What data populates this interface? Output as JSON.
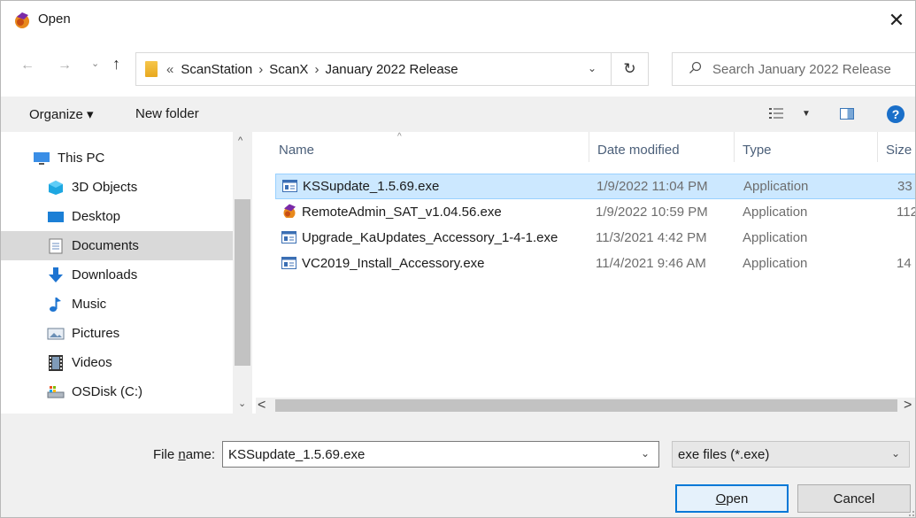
{
  "window": {
    "title": "Open",
    "close_glyph": "✕"
  },
  "nav": {
    "back_glyph": "←",
    "forward_glyph": "→",
    "recent_glyph": "⌄",
    "up_glyph": "↑",
    "breadcrumb": {
      "overflow_glyph": "«",
      "separator": "›",
      "parts": [
        "ScanStation",
        "ScanX",
        "January 2022 Release"
      ]
    },
    "address_dropdown_glyph": "⌄",
    "refresh_glyph": "↻",
    "search_icon_glyph": "⚲",
    "search_placeholder": "Search January 2022 Release"
  },
  "toolbar": {
    "organize_label": "Organize ▾",
    "new_folder_label": "New folder",
    "view_dropdown_glyph": "▼",
    "help_glyph": "?"
  },
  "sidebar": {
    "scroll_up_glyph": "^",
    "scroll_down_glyph": "⌄",
    "items": [
      {
        "label": "This PC",
        "icon": "computer-icon",
        "selected": false
      },
      {
        "label": "3D Objects",
        "icon": "cube-icon",
        "selected": false
      },
      {
        "label": "Desktop",
        "icon": "desktop-icon",
        "selected": false
      },
      {
        "label": "Documents",
        "icon": "document-icon",
        "selected": true
      },
      {
        "label": "Downloads",
        "icon": "download-icon",
        "selected": false
      },
      {
        "label": "Music",
        "icon": "music-note-icon",
        "selected": false
      },
      {
        "label": "Pictures",
        "icon": "pictures-icon",
        "selected": false
      },
      {
        "label": "Videos",
        "icon": "film-icon",
        "selected": false
      },
      {
        "label": "OSDisk (C:)",
        "icon": "drive-icon",
        "selected": false
      }
    ]
  },
  "filelist": {
    "sort_glyph": "^",
    "columns": [
      "Name",
      "Date modified",
      "Type",
      "Size"
    ],
    "rows": [
      {
        "name": "KSSupdate_1.5.69.exe",
        "date": "1/9/2022 11:04 PM",
        "type": "Application",
        "size": "33",
        "icon": "exe-icon",
        "selected": true
      },
      {
        "name": "RemoteAdmin_SAT_v1.04.56.exe",
        "date": "1/9/2022 10:59 PM",
        "type": "Application",
        "size": "112",
        "icon": "app-logo-icon",
        "selected": false
      },
      {
        "name": "Upgrade_KaUpdates_Accessory_1-4-1.exe",
        "date": "11/3/2021 4:42 PM",
        "type": "Application",
        "size": "",
        "icon": "exe-icon",
        "selected": false
      },
      {
        "name": "VC2019_Install_Accessory.exe",
        "date": "11/4/2021 9:46 AM",
        "type": "Application",
        "size": "14",
        "icon": "exe-icon",
        "selected": false
      }
    ],
    "scroll_left_glyph": "<",
    "scroll_right_glyph": ">"
  },
  "footer": {
    "filename_label_prefix": "File ",
    "filename_label_underlined": "n",
    "filename_label_suffix": "ame:",
    "filename_value": "KSSupdate_1.5.69.exe",
    "filename_dropdown_glyph": "⌄",
    "filter_value": "exe files (*.exe)",
    "filter_dropdown_glyph": "⌄",
    "open_label_underlined": "O",
    "open_label_rest": "pen",
    "cancel_label": "Cancel"
  },
  "colors": {
    "selection_fill": "#cce8ff",
    "selection_border": "#99d1ff",
    "sidebar_selected": "#d9d9d9",
    "accent": "#0078d7",
    "help_blue": "#1a6fc9"
  }
}
